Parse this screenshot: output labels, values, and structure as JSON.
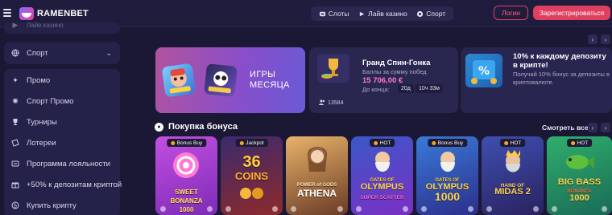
{
  "header": {
    "logo_text": "RAMENBET",
    "nav": [
      {
        "label": "Слоты",
        "icon": "slots-icon"
      },
      {
        "label": "Лайв казино",
        "icon": "live-casino-icon"
      },
      {
        "label": "Спорт",
        "icon": "soccer-ball-icon"
      }
    ],
    "login_label": "Логин",
    "register_label": "Зарегистрироваться"
  },
  "sidebar": {
    "faded_top": "Лайв казино",
    "sport_label": "Спорт",
    "items": [
      {
        "label": "Промо",
        "icon": "promo-icon"
      },
      {
        "label": "Спорт Промо",
        "icon": "sport-promo-icon"
      },
      {
        "label": "Турниры",
        "icon": "trophy-icon"
      },
      {
        "label": "Лотереи",
        "icon": "ticket-icon"
      },
      {
        "label": "Программа лояльности",
        "icon": "loyalty-icon"
      },
      {
        "label": "+50% к депозитам криптой",
        "icon": "gift-icon"
      },
      {
        "label": "Купить крипту",
        "icon": "crypto-icon"
      }
    ]
  },
  "promo_games": {
    "title_line1": "ИГРЫ",
    "title_line2": "МЕСЯЦА"
  },
  "tournament": {
    "title": "Гранд Спин-Гонка",
    "subtitle": "Баллы за сумму побед",
    "amount": "15 706,00 €",
    "until_label": "До конца:",
    "days": "20д",
    "time": "10ч 33м",
    "players": "13584"
  },
  "cashback": {
    "title": "10% к каждому депозиту в крипте!",
    "text": "Получай 10% бонус за депозиты в криптовалюте."
  },
  "bonus_section": {
    "title": "Покупка бонуса",
    "see_all": "Смотреть все",
    "games": [
      {
        "name": "Sweet Bonanza 1000",
        "badge": "Bonus Buy",
        "badge_dot": true
      },
      {
        "name": "36 Coins",
        "badge": "Jackpot",
        "badge_dot": true
      },
      {
        "name": "Power of Gods Athena",
        "badge": "",
        "badge_dot": false
      },
      {
        "name": "Gates of Olympus Super Scatter",
        "badge": "HOT",
        "badge_dot": true
      },
      {
        "name": "Gates of Olympus 1000",
        "badge": "Bonus Buy",
        "badge_dot": true
      },
      {
        "name": "Hand of Midas 2",
        "badge": "HOT",
        "badge_dot": true
      },
      {
        "name": "Big Bass Bonanza 1000",
        "badge": "HOT",
        "badge_dot": true
      }
    ]
  },
  "colors": {
    "background": "#1b1835",
    "accent": "#e0405f",
    "amount": "#ff7ad0"
  }
}
